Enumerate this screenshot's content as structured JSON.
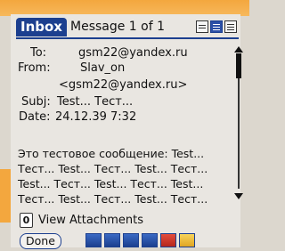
{
  "header": {
    "inbox_label": "Inbox",
    "message_counter": "Message 1 of 1"
  },
  "fields": {
    "to_label": "To:",
    "to_value": "gsm22@yandex.ru",
    "from_label": "From:",
    "from_name": "Slav_on",
    "from_email": "<gsm22@yandex.ru>",
    "subj_label": "Subj:",
    "subj_value": "Test... Тест...",
    "date_label": "Date:",
    "date_value": "24.12.39 7:32"
  },
  "body": {
    "lines": [
      "Это тестовое сообщение: Test...",
      "Тест... Test... Тест... Test... Тест...",
      "Test... Тест... Test... Тест... Test...",
      "Тест... Test... Тест... Test... Тест..."
    ]
  },
  "attachments": {
    "label": "View Attachments",
    "icon_text": "0"
  },
  "footer": {
    "done_label": "Done",
    "toolbar_icons": [
      "reply-icon",
      "reply-all-icon",
      "forward-icon",
      "file-icon",
      "delete-icon",
      "unread-icon"
    ]
  },
  "colors": {
    "accent": "#1c3f8f",
    "background": "#e9e6e1",
    "frame": "#f3a73e"
  }
}
